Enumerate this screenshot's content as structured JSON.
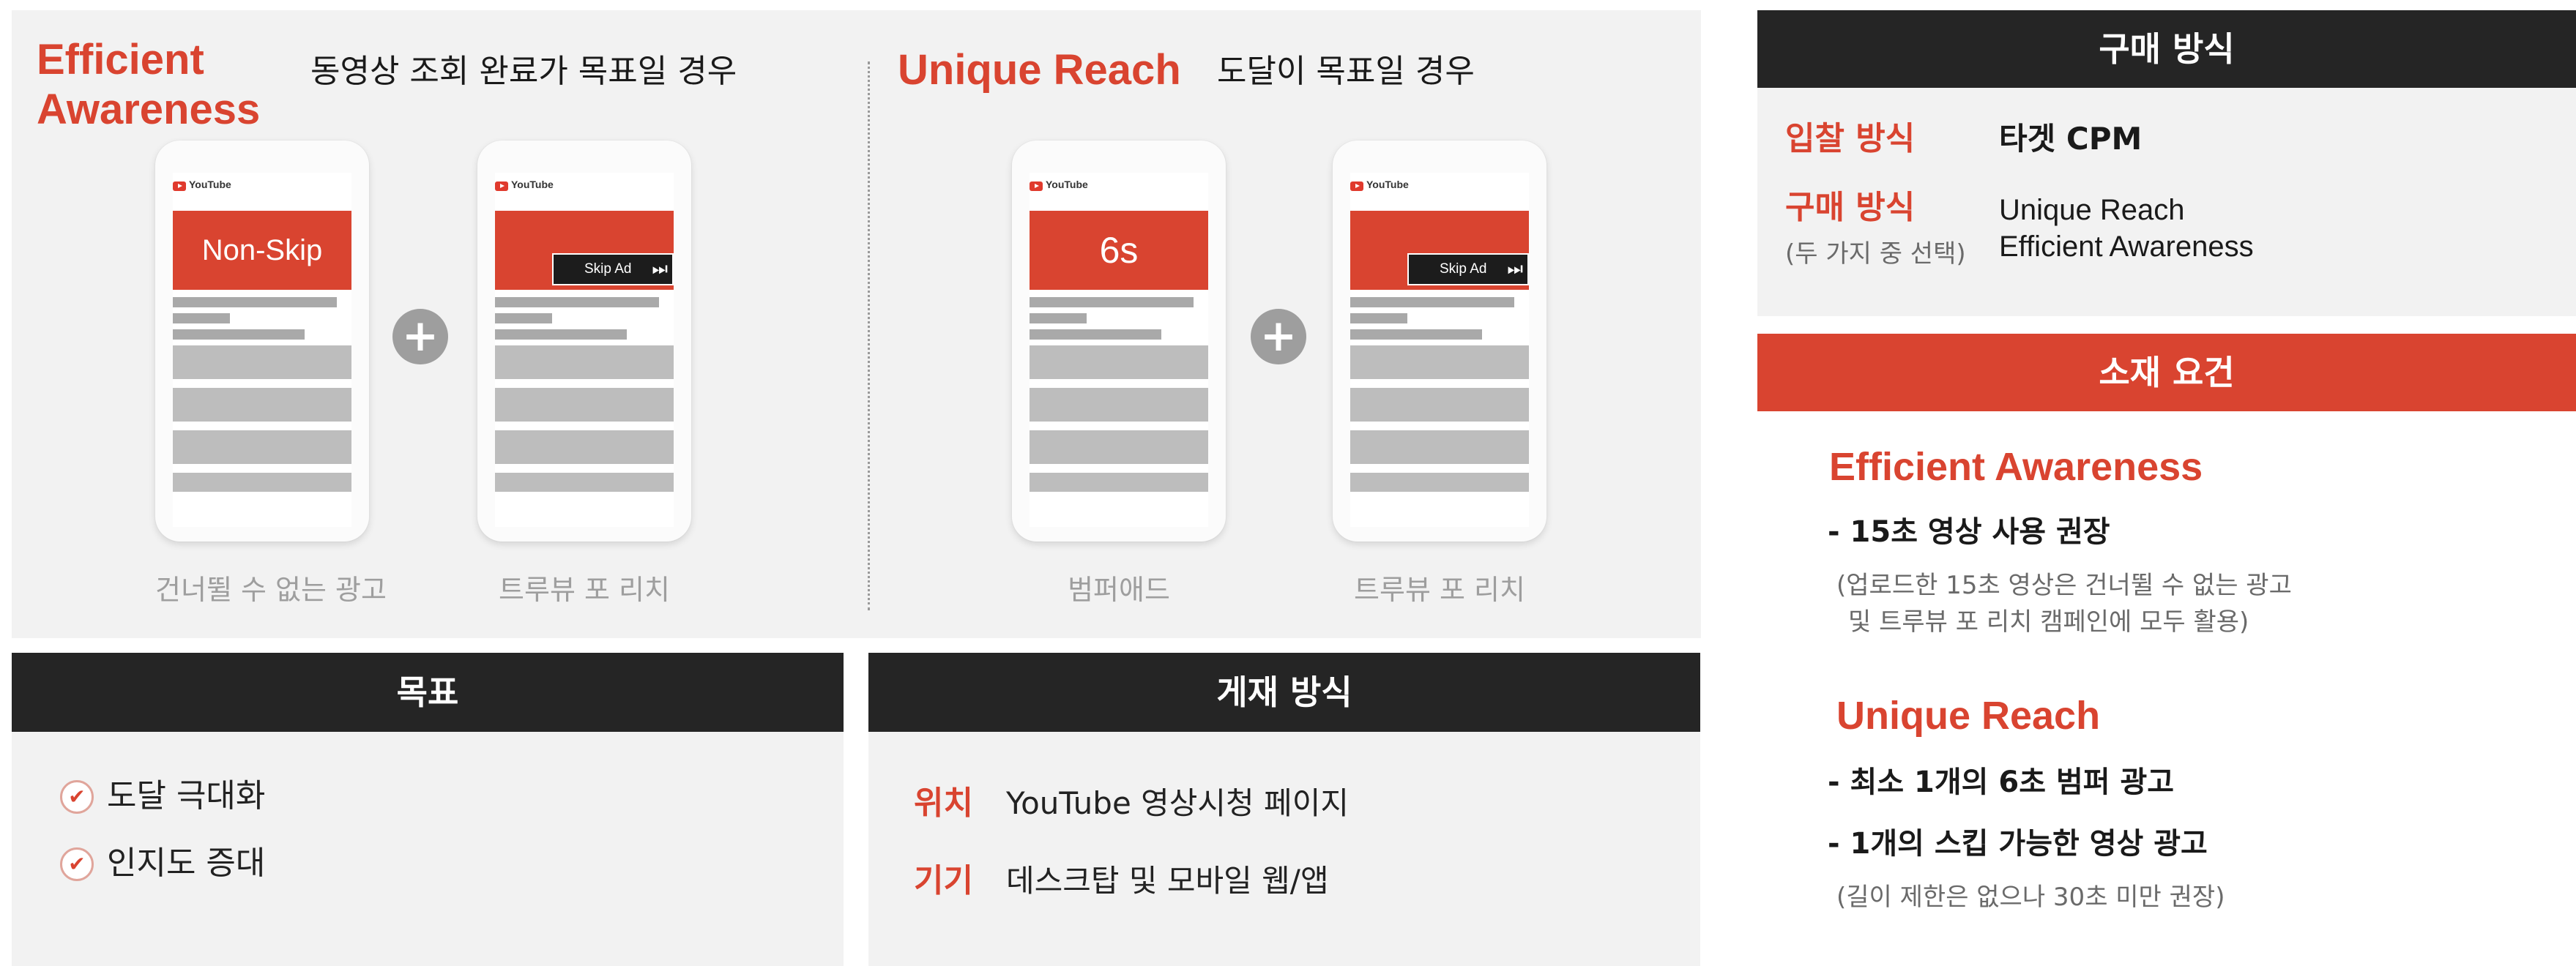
{
  "top": {
    "efficient": {
      "title_line1": "Efficient",
      "title_line2": "Awareness",
      "subtitle": "동영상 조회 완료가 목표일 경우",
      "phones": [
        {
          "video_label": "Non-Skip",
          "caption": "건너뛸 수 없는 광고"
        },
        {
          "skip_label": "Skip Ad",
          "caption": "트루뷰 포 리치"
        }
      ]
    },
    "unique": {
      "title": "Unique Reach",
      "subtitle": "도달이 목표일 경우",
      "phones": [
        {
          "video_label": "6s",
          "caption": "범퍼애드"
        },
        {
          "skip_label": "Skip Ad",
          "caption": "트루뷰 포 리치"
        }
      ]
    },
    "plus_symbol": "+",
    "youtube_text": "YouTube"
  },
  "goal": {
    "header": "목표",
    "items": [
      "도달 극대화",
      "인지도 증대"
    ],
    "check_symbol": "✔"
  },
  "placement": {
    "header": "게재 방식",
    "rows": [
      {
        "label": "위치",
        "value": "YouTube 영상시청 페이지"
      },
      {
        "label": "기기",
        "value": "데스크탑 및 모바일 웹/앱"
      }
    ]
  },
  "purchase": {
    "header": "구매 방식",
    "bid_label": "입찰 방식",
    "bid_value": "타겟 CPM",
    "buy_label": "구매 방식",
    "buy_note": "(두 가지 중 선택)",
    "buy_options": [
      "Unique Reach",
      "Efficient Awareness"
    ]
  },
  "requirements": {
    "header": "소재 요건",
    "efficient": {
      "title": "Efficient Awareness",
      "item": "- 15초 영상 사용 권장",
      "note_line1": "(업로드한 15초 영상은 건너뛸 수 없는 광고",
      "note_line2": "및 트루뷰 포 리치 캠페인에 모두 활용)"
    },
    "unique": {
      "title": "Unique Reach",
      "item1": "- 최소 1개의 6초 범퍼 광고",
      "item2": "- 1개의 스킵 가능한 영상 광고",
      "note": "(길이 제한은 없으나 30초 미만 권장)"
    }
  },
  "colors": {
    "accent_red": "#d94430",
    "dark_header": "#252525",
    "panel_bg": "#f2f2f2",
    "caption_gray": "#9e9e9e"
  }
}
